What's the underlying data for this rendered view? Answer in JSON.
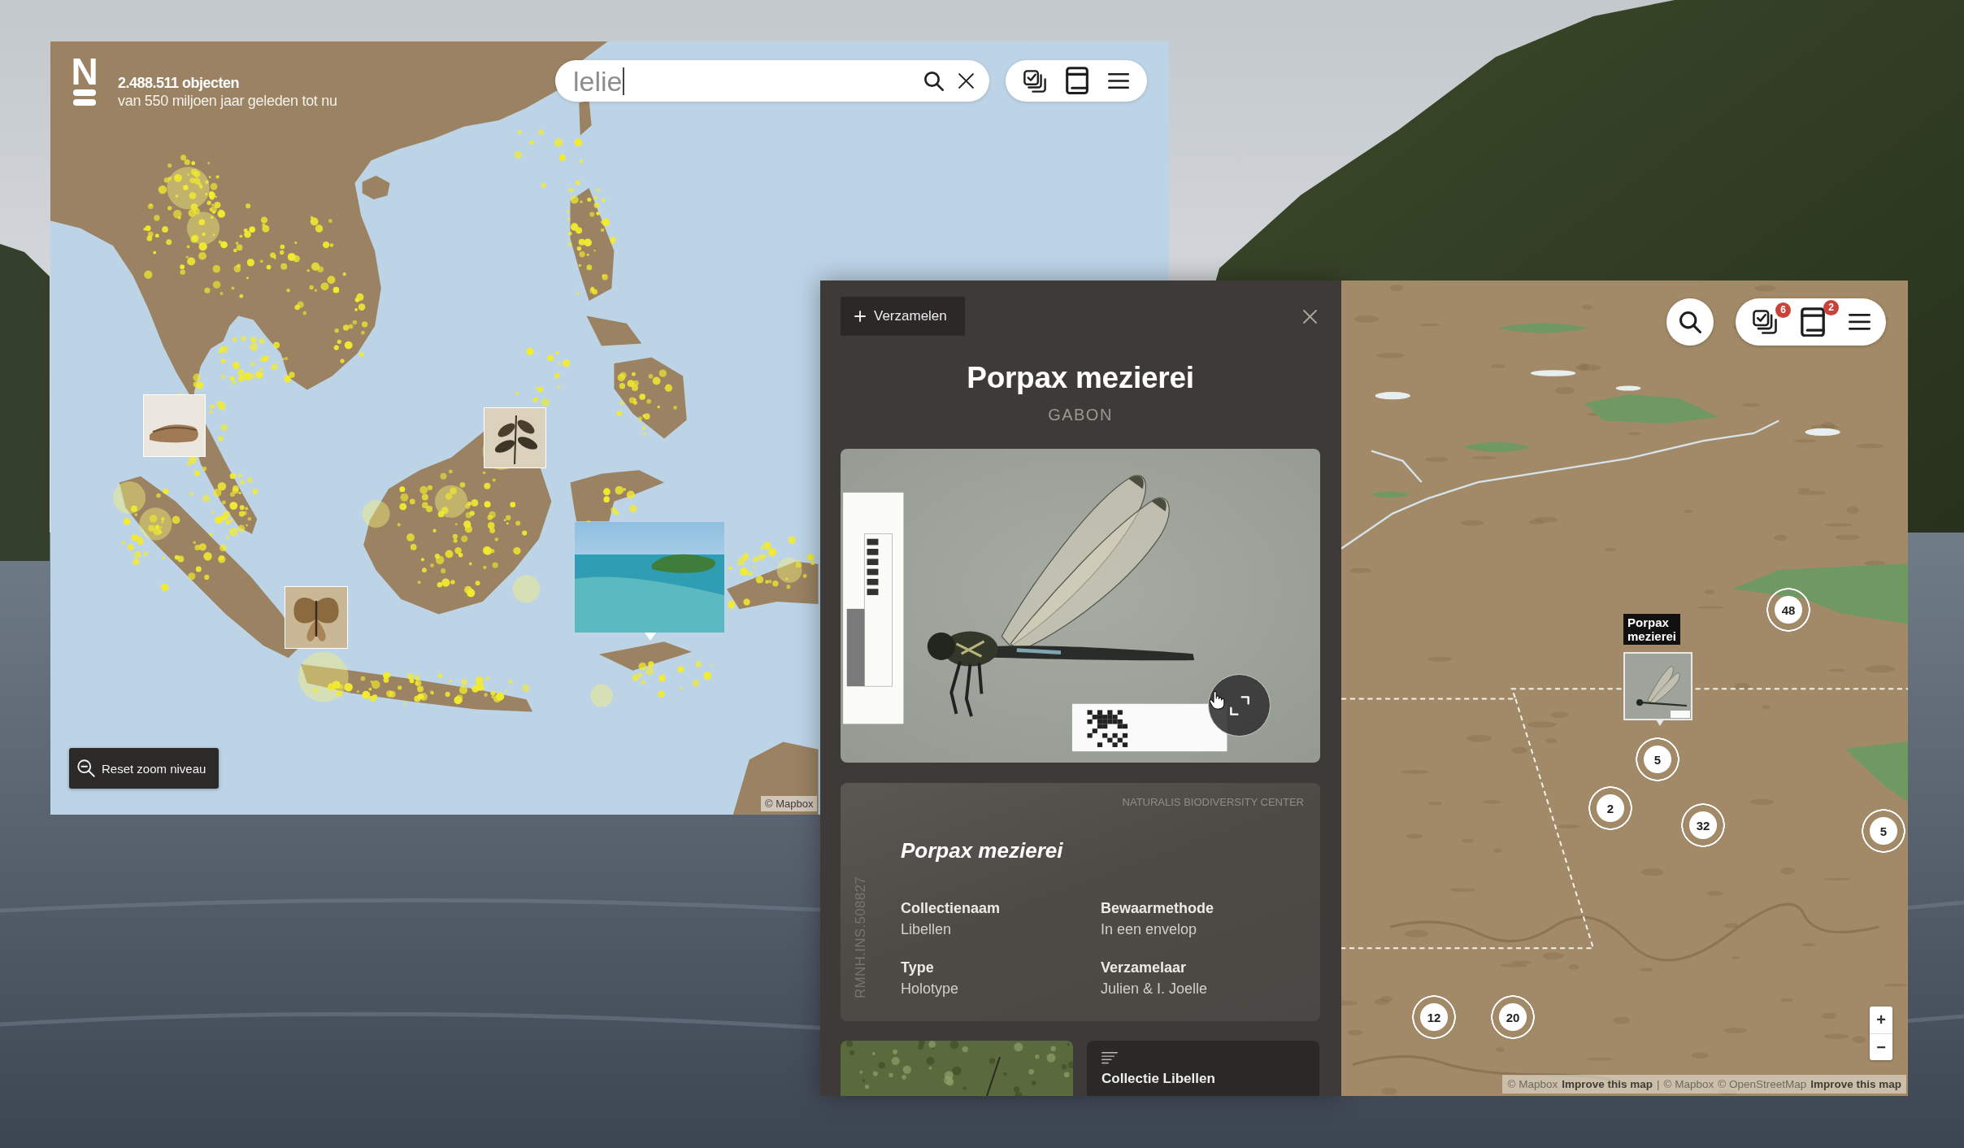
{
  "explore_map": {
    "logo": "N",
    "object_count": "2.488.511 objecten",
    "time_range": "van 550 miljoen jaar geleden tot nu",
    "search": {
      "value": "lelie"
    },
    "toolbar": [
      {
        "kind": "collection"
      },
      {
        "kind": "book"
      },
      {
        "kind": "menu"
      }
    ],
    "reset_zoom_button": "Reset zoom niveau",
    "attribution": "© Mapbox"
  },
  "detail_panel": {
    "collect_button": "Verzamelen",
    "title": "Porpax mezierei",
    "country": "GABON",
    "record": {
      "institution": "NATURALIS BIODIVERSITY CENTER",
      "registration_number": "RMNH.INS.508827",
      "name": "Porpax mezierei",
      "fields": [
        {
          "label": "Collectienaam",
          "value": "Libellen"
        },
        {
          "label": "Bewaarmethode",
          "value": "In een envelop"
        },
        {
          "label": "Type",
          "value": "Holotype"
        },
        {
          "label": "Verzamelaar",
          "value": "Julien & I. Joelle"
        }
      ]
    },
    "related": [
      {
        "kind": "photo"
      },
      {
        "kind": "collection",
        "title": "Collectie Libellen"
      }
    ]
  },
  "species_map": {
    "toolbar": [
      {
        "kind": "collection",
        "badge": "6"
      },
      {
        "kind": "book",
        "badge": "2"
      },
      {
        "kind": "menu"
      }
    ],
    "specimen_marker": {
      "label": "Porpax mezierei"
    },
    "clusters": [
      {
        "count": "48"
      },
      {
        "count": "5"
      },
      {
        "count": "2"
      },
      {
        "count": "32"
      },
      {
        "count": "5"
      },
      {
        "count": "12"
      },
      {
        "count": "20"
      }
    ],
    "zoom_in": "+",
    "zoom_out": "−",
    "attribution": [
      {
        "kind": "text",
        "text": "© Mapbox"
      },
      {
        "kind": "link",
        "text": "Improve this map"
      },
      {
        "kind": "separator",
        "text": "|"
      },
      {
        "kind": "text",
        "text": "© Mapbox"
      },
      {
        "kind": "text",
        "text": "© OpenStreetMap"
      },
      {
        "kind": "link",
        "text": "Improve this map"
      }
    ]
  }
}
